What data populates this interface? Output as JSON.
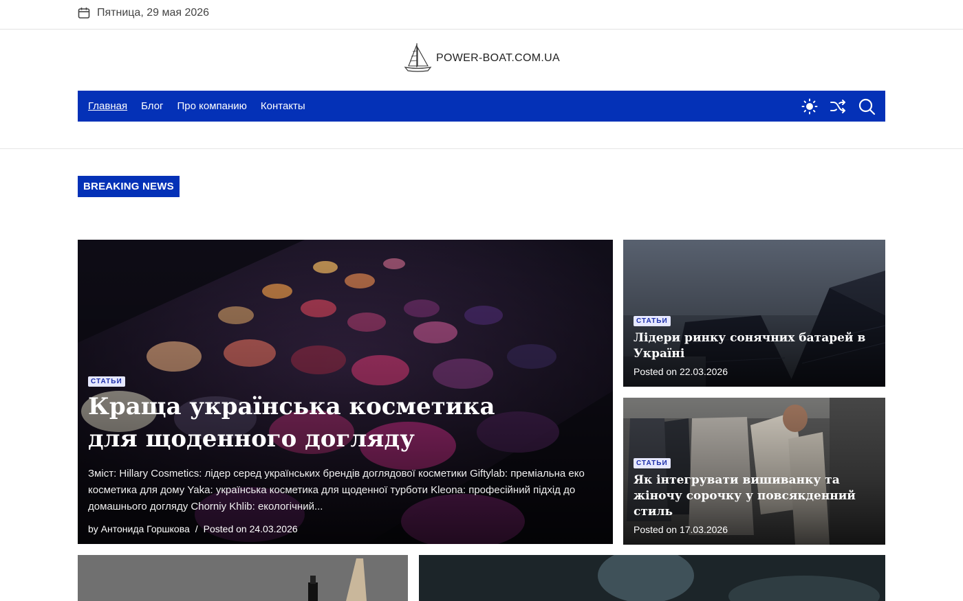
{
  "topbar": {
    "date": "Пятница, 29 мая 2026",
    "icon": "calendar-icon"
  },
  "brand": {
    "name": "POWER-BOAT.COM.UA",
    "logo_icon": "sailboat-icon"
  },
  "nav": {
    "items": [
      {
        "label": "Главная",
        "active": true
      },
      {
        "label": "Блог"
      },
      {
        "label": "Про компанию"
      },
      {
        "label": "Контакты"
      }
    ],
    "tools": [
      "sun-icon",
      "shuffle-icon",
      "search-icon"
    ],
    "color": "#0431b7"
  },
  "breaking": {
    "label": "BREAKING NEWS"
  },
  "main_post": {
    "category": "СТАТЬИ",
    "title": "Краща українська косметика для щоденного догляду",
    "excerpt": "Зміст: Hillary Cosmetics: лідер серед українських брендів доглядової косметики Giftylab: преміальна еко косметика для дому Yaka: українська косметика для щоденної турботи Kleona: професійний підхід до домашнього догляду Chorniy Khlib: екологічний...",
    "author": "by Антонида Горшкова",
    "separator": "/",
    "posted": "Posted on 24.03.2026"
  },
  "side_posts": [
    {
      "category": "СТАТЬИ",
      "title": "Лідери ринку сонячних батарей в Україні",
      "posted": "Posted on 22.03.2026"
    },
    {
      "category": "СТАТЬИ",
      "title": "Як інтегрувати вишиванку та жіночу сорочку у повсякденний стиль",
      "posted": "Posted on 17.03.2026"
    }
  ]
}
